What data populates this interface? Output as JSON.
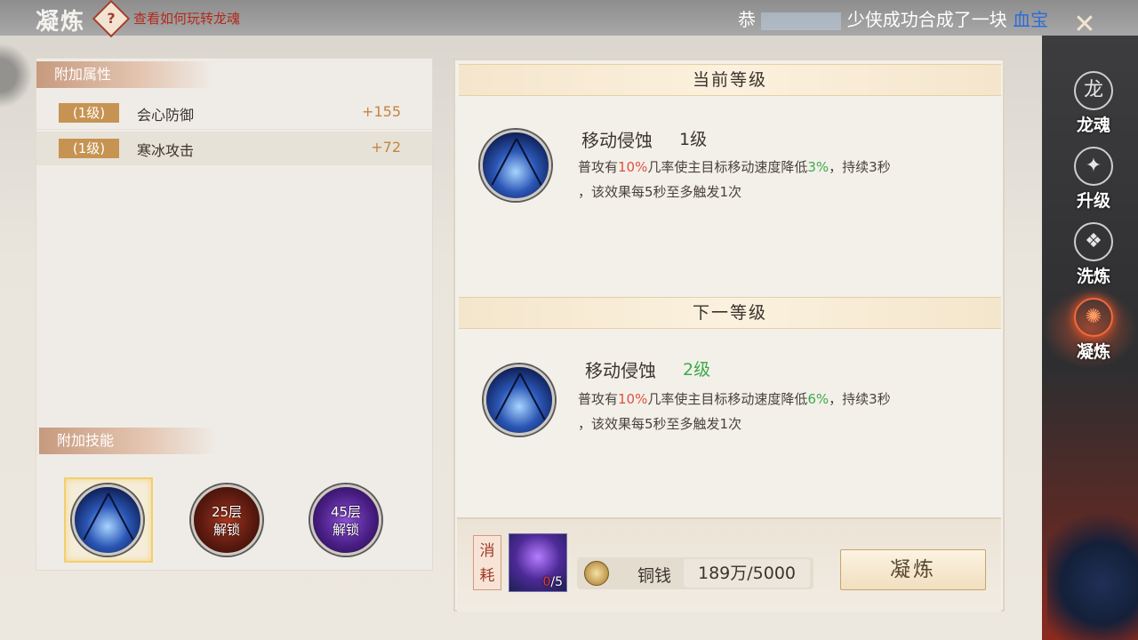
{
  "header": {
    "title": "凝炼",
    "help_link": "查看如何玩转龙魂",
    "marquee_prefix": "恭",
    "marquee_text": "少侠成功合成了一块",
    "marquee_item": "血宝"
  },
  "left": {
    "attr_section": "附加属性",
    "attributes": [
      {
        "level": "(1级)",
        "name": "会心防御",
        "value": "+155"
      },
      {
        "level": "(1级)",
        "name": "寒冰攻击",
        "value": "+72"
      }
    ],
    "skill_section": "附加技能",
    "locked_slots": [
      {
        "line1": "25层",
        "line2": "解锁"
      },
      {
        "line1": "45层",
        "line2": "解锁"
      }
    ]
  },
  "right": {
    "current_header": "当前等级",
    "next_header": "下一等级",
    "current": {
      "name": "移动侵蚀",
      "level": "1级",
      "desc_a": "普攻有",
      "chance": "10%",
      "desc_b": "几率使主目标移动速度降低",
      "reduce": "3%",
      "desc_c": "，持续3秒",
      "desc_d": "，该效果每5秒至多触发1次"
    },
    "next": {
      "name": "移动侵蚀",
      "level": "2级",
      "desc_a": "普攻有",
      "chance": "10%",
      "desc_b": "几率使主目标移动速度降低",
      "reduce": "6%",
      "desc_c": "，持续3秒",
      "desc_d": "，该效果每5秒至多触发1次"
    },
    "cost": {
      "tag": "消耗",
      "mat_have": "0",
      "mat_need": "/5",
      "coin_label": "铜钱",
      "coin_value": "189万/5000"
    },
    "refine_button": "凝炼"
  },
  "nav": [
    {
      "label": "龙魂",
      "icon": "dragon-icon"
    },
    {
      "label": "升级",
      "icon": "flame-icon"
    },
    {
      "label": "洗炼",
      "icon": "scroll-icon"
    },
    {
      "label": "凝炼",
      "icon": "refine-icon"
    }
  ],
  "colors": {
    "highlight_red": "#e0523d",
    "highlight_green": "#3eaa49",
    "value_gold": "#c4853d",
    "nav_active": "#f26a3c"
  }
}
